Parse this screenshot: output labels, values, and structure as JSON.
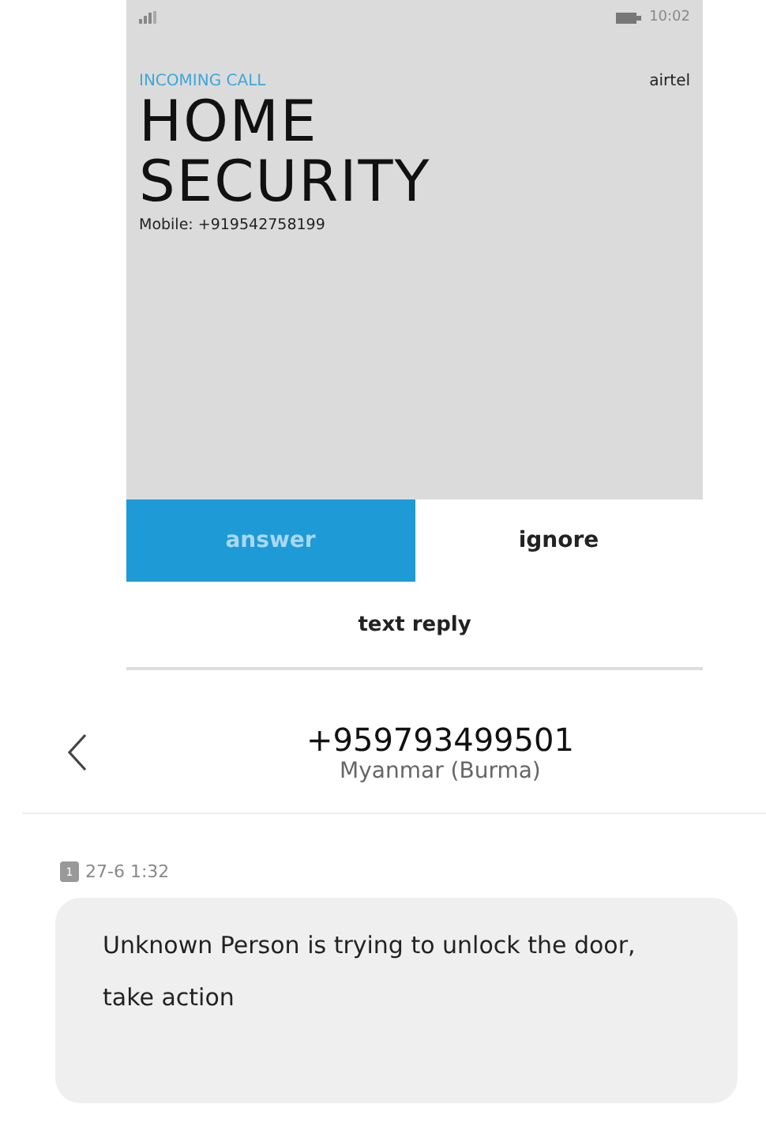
{
  "call_screen": {
    "status_bar": {
      "time": "10:02"
    },
    "label": "INCOMING CALL",
    "carrier": "airtel",
    "caller_name": "HOME SECURITY",
    "caller_number": "Mobile: +919542758199",
    "actions": [
      {
        "label": "answer",
        "primary": true
      },
      {
        "label": "ignore",
        "primary": false
      }
    ],
    "text_reply": "text reply"
  },
  "conversation": {
    "number": "+959793499501",
    "country": "Myanmar (Burma)",
    "sim_slot": "1",
    "timestamp": "27-6 1:32",
    "message": "Unknown Person is trying to unlock the door, take action"
  }
}
